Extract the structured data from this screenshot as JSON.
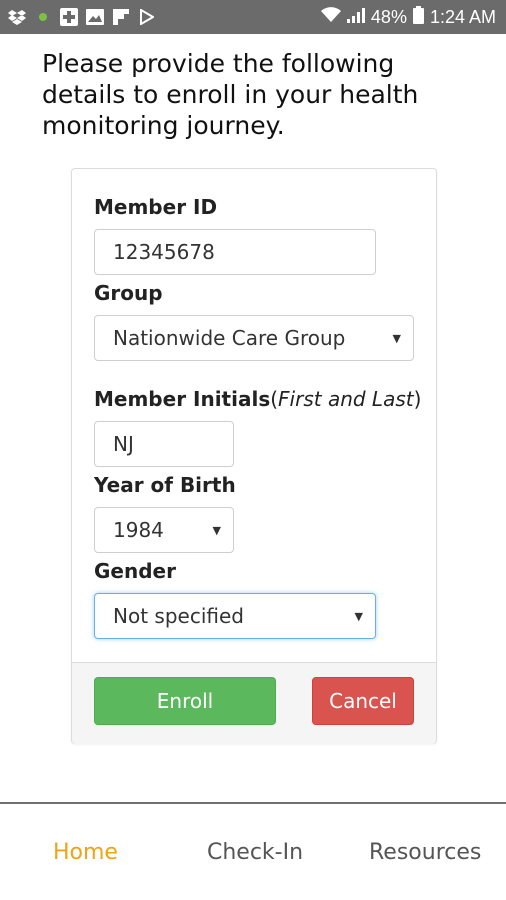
{
  "status_bar": {
    "battery": "48%",
    "time": "1:24 AM",
    "left_icons": [
      "dropbox-icon",
      "green-dot-icon",
      "plus-square-icon",
      "image-icon",
      "flipboard-icon",
      "play-icon"
    ],
    "right_icons": [
      "wifi-icon",
      "signal-icon",
      "battery-icon"
    ]
  },
  "intro": {
    "text": "Please provide the following details to enroll in your health monitoring journey."
  },
  "form": {
    "member_id_label": "Member ID",
    "member_id_value": "12345678",
    "group_label": "Group",
    "group_value": "Nationwide Care Group",
    "initials_label": "Member Initials",
    "initials_hint": "First and Last",
    "initials_value": "NJ",
    "year_label": "Year of Birth",
    "year_value": "1984",
    "gender_label": "Gender",
    "gender_value": "Not specified"
  },
  "actions": {
    "enroll": "Enroll",
    "cancel": "Cancel"
  },
  "nav": {
    "home": "Home",
    "checkin": "Check-In",
    "resources": "Resources"
  },
  "colors": {
    "accent": "#f0a316",
    "enroll": "#5cb85c",
    "cancel": "#d9534f"
  }
}
